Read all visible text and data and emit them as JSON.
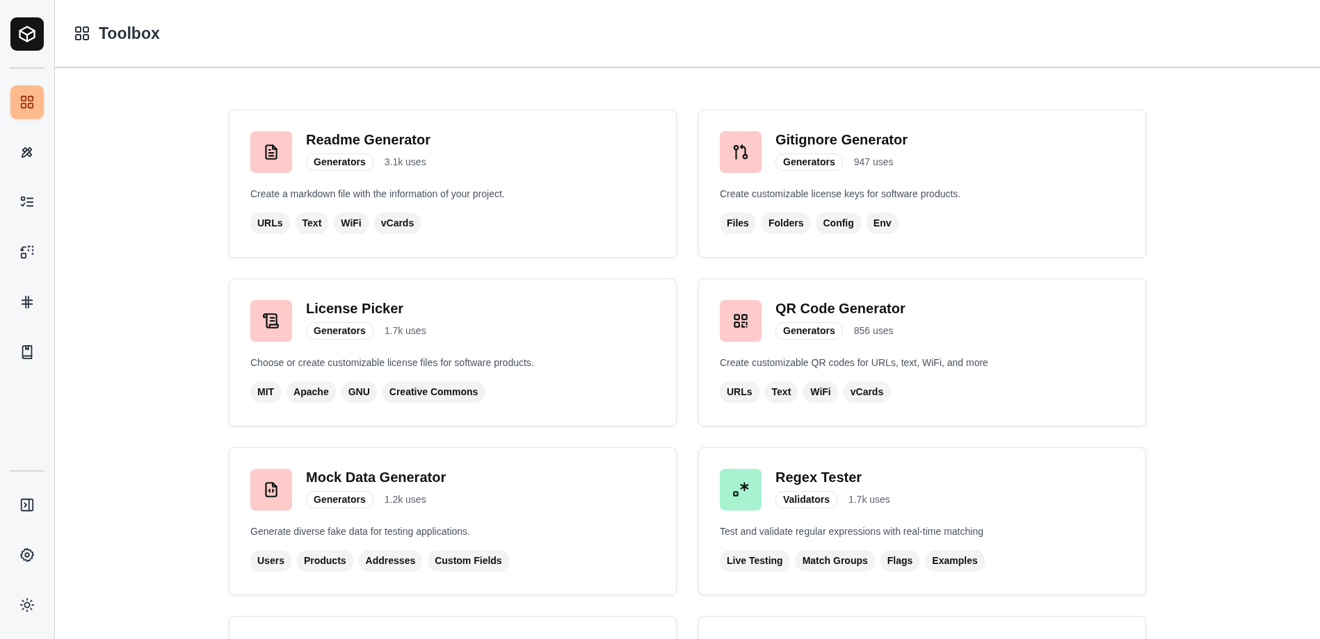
{
  "header": {
    "title": "Toolbox"
  },
  "sidebar": {
    "items": [
      {
        "selected": true
      },
      {
        "selected": false
      },
      {
        "selected": false
      },
      {
        "selected": false
      },
      {
        "selected": false
      },
      {
        "selected": false
      }
    ]
  },
  "tools": [
    {
      "name": "Readme Generator",
      "category": "Generators",
      "uses": "3.1k uses",
      "color": "#fecaca",
      "description": "Create a markdown file with the information of your project.",
      "tags": [
        "URLs",
        "Text",
        "WiFi",
        "vCards"
      ]
    },
    {
      "name": "Gitignore Generator",
      "category": "Generators",
      "uses": "947 uses",
      "color": "#fecaca",
      "description": "Create customizable license keys for software products.",
      "tags": [
        "Files",
        "Folders",
        "Config",
        "Env"
      ]
    },
    {
      "name": "License Picker",
      "category": "Generators",
      "uses": "1.7k uses",
      "color": "#fecaca",
      "description": "Choose or create customizable license files for software products.",
      "tags": [
        "MIT",
        "Apache",
        "GNU",
        "Creative Commons"
      ]
    },
    {
      "name": "QR Code Generator",
      "category": "Generators",
      "uses": "856 uses",
      "color": "#fecaca",
      "description": "Create customizable QR codes for URLs, text, WiFi, and more",
      "tags": [
        "URLs",
        "Text",
        "WiFi",
        "vCards"
      ]
    },
    {
      "name": "Mock Data Generator",
      "category": "Generators",
      "uses": "1.2k uses",
      "color": "#fecaca",
      "description": "Generate diverse fake data for testing applications.",
      "tags": [
        "Users",
        "Products",
        "Addresses",
        "Custom Fields"
      ]
    },
    {
      "name": "Regex Tester",
      "category": "Validators",
      "uses": "1.7k uses",
      "color": "#a7f3d0",
      "description": "Test and validate regular expressions with real-time matching",
      "tags": [
        "Live Testing",
        "Match Groups",
        "Flags",
        "Examples"
      ]
    }
  ]
}
